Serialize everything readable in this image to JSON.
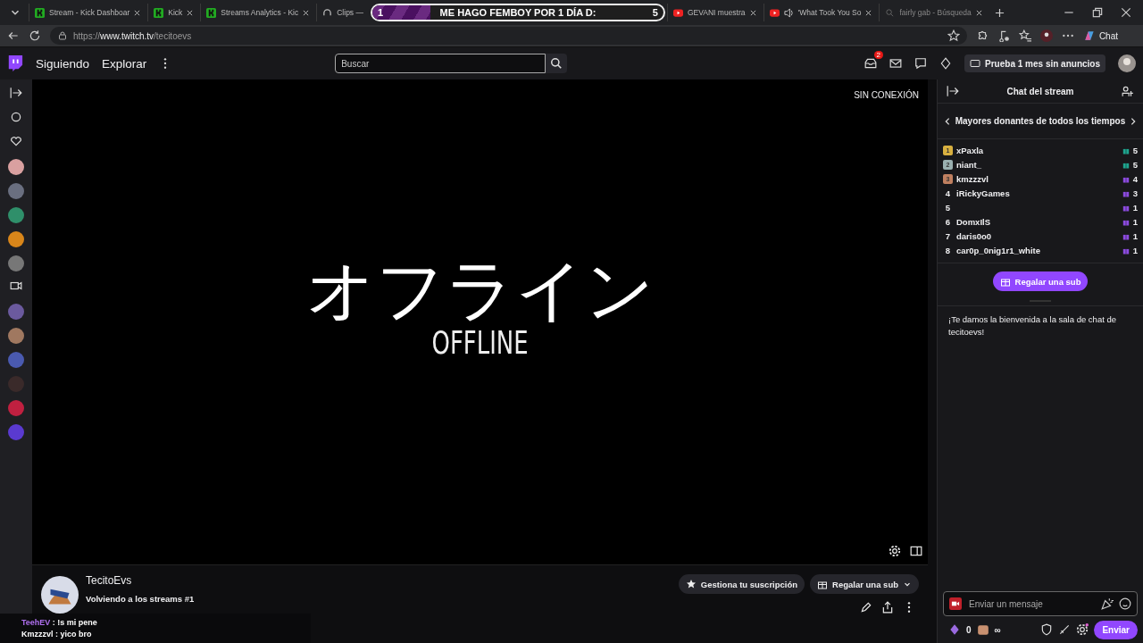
{
  "browser": {
    "tabs": [
      {
        "title": "Stream - Kick Dashboar",
        "kind": "kick",
        "selected": false
      },
      {
        "title": "Kick",
        "kind": "kick",
        "selected": false
      },
      {
        "title": "Streams Analytics - Kic",
        "kind": "kick",
        "selected": false
      },
      {
        "title": "Clips —",
        "kind": "clips",
        "selected": false
      },
      {
        "title": "GEVANI muestra",
        "kind": "youtube",
        "selected": false
      },
      {
        "title": "'What Took You So",
        "kind": "youtube-audio",
        "selected": false
      },
      {
        "title": "fairly gab - Búsqueda",
        "kind": "search",
        "selected": false
      }
    ],
    "url_prefix": "https://",
    "url_host": "www.twitch.tv",
    "url_path": "/tecitoevs",
    "chat_button": "Chat"
  },
  "goal_overlay": {
    "start": "1",
    "title": "ME HAGO FEMBOY POR 1 DÍA D:",
    "end": "5",
    "level": 0.2
  },
  "nav": {
    "links": [
      "Siguiendo",
      "Explorar"
    ],
    "search": {
      "placeholder": "Buscar"
    },
    "inbox_badge": "2",
    "promo": "Prueba 1 mes sin anuncios"
  },
  "sidebar": {
    "channels": [
      {
        "color": "#d9a0a0"
      },
      {
        "color": "#6a6f80"
      },
      {
        "color": "#2f8f6a"
      },
      {
        "color": "#d9861a"
      },
      {
        "color": "#777777"
      },
      {
        "kind": "camera"
      },
      {
        "color": "#6b5a9e"
      },
      {
        "color": "#a07860"
      },
      {
        "color": "#4a5ab0"
      },
      {
        "color": "#3a2a2a"
      },
      {
        "color": "#c02040"
      },
      {
        "color": "#5a3ad0"
      }
    ]
  },
  "player": {
    "status": "SIN CONEXIÓN",
    "offline_jp": "オフライン",
    "offline_en": "OFFLINE"
  },
  "channel": {
    "name": "TecitoEvs",
    "title": "Volviendo a los streams #1",
    "buttons": [
      "Gestiona tu suscripción",
      "Regalar una sub"
    ]
  },
  "overlay_chat": [
    {
      "user": "TeehEV",
      "text": " : !s mi pene",
      "color": "#b070f0"
    },
    {
      "user": "Kmzzzvl",
      "text": " : yico bro",
      "color": "#ffffff"
    }
  ],
  "chat": {
    "title": "Chat del stream",
    "leaderboard_title": "Mayores donantes de todos los tiempos",
    "donors": [
      {
        "rank": "1",
        "kind": "medal",
        "name": "xPaxla",
        "count": "5",
        "color": "#1fa58f"
      },
      {
        "rank": "2",
        "kind": "medal",
        "name": "niant_",
        "count": "5",
        "color": "#1fa58f"
      },
      {
        "rank": "3",
        "kind": "medal",
        "name": "kmzzzvl",
        "count": "4",
        "color": "#8c4be0"
      },
      {
        "rank": "4",
        "kind": "number",
        "name": "iRickyGames",
        "count": "3",
        "color": "#8c4be0"
      },
      {
        "rank": "5",
        "kind": "number",
        "count": "1",
        "color": "#8c4be0"
      },
      {
        "rank": "6",
        "kind": "number",
        "name": "DomxIlS",
        "count": "1",
        "color": "#8c4be0"
      },
      {
        "rank": "7",
        "kind": "number",
        "name": "daris0o0",
        "count": "1",
        "color": "#8c4be0"
      },
      {
        "rank": "8",
        "kind": "number",
        "name": "car0p_0nig1r1_white",
        "count": "1",
        "color": "#8c4be0"
      }
    ],
    "gift_button": "Regalar una sub",
    "welcome": "¡Te damos la bienvenida a la sala de chat de tecitoevs!",
    "input": {
      "placeholder": "Enviar un mensaje"
    },
    "points": "0",
    "infinity": "∞",
    "send": "Enviar"
  }
}
